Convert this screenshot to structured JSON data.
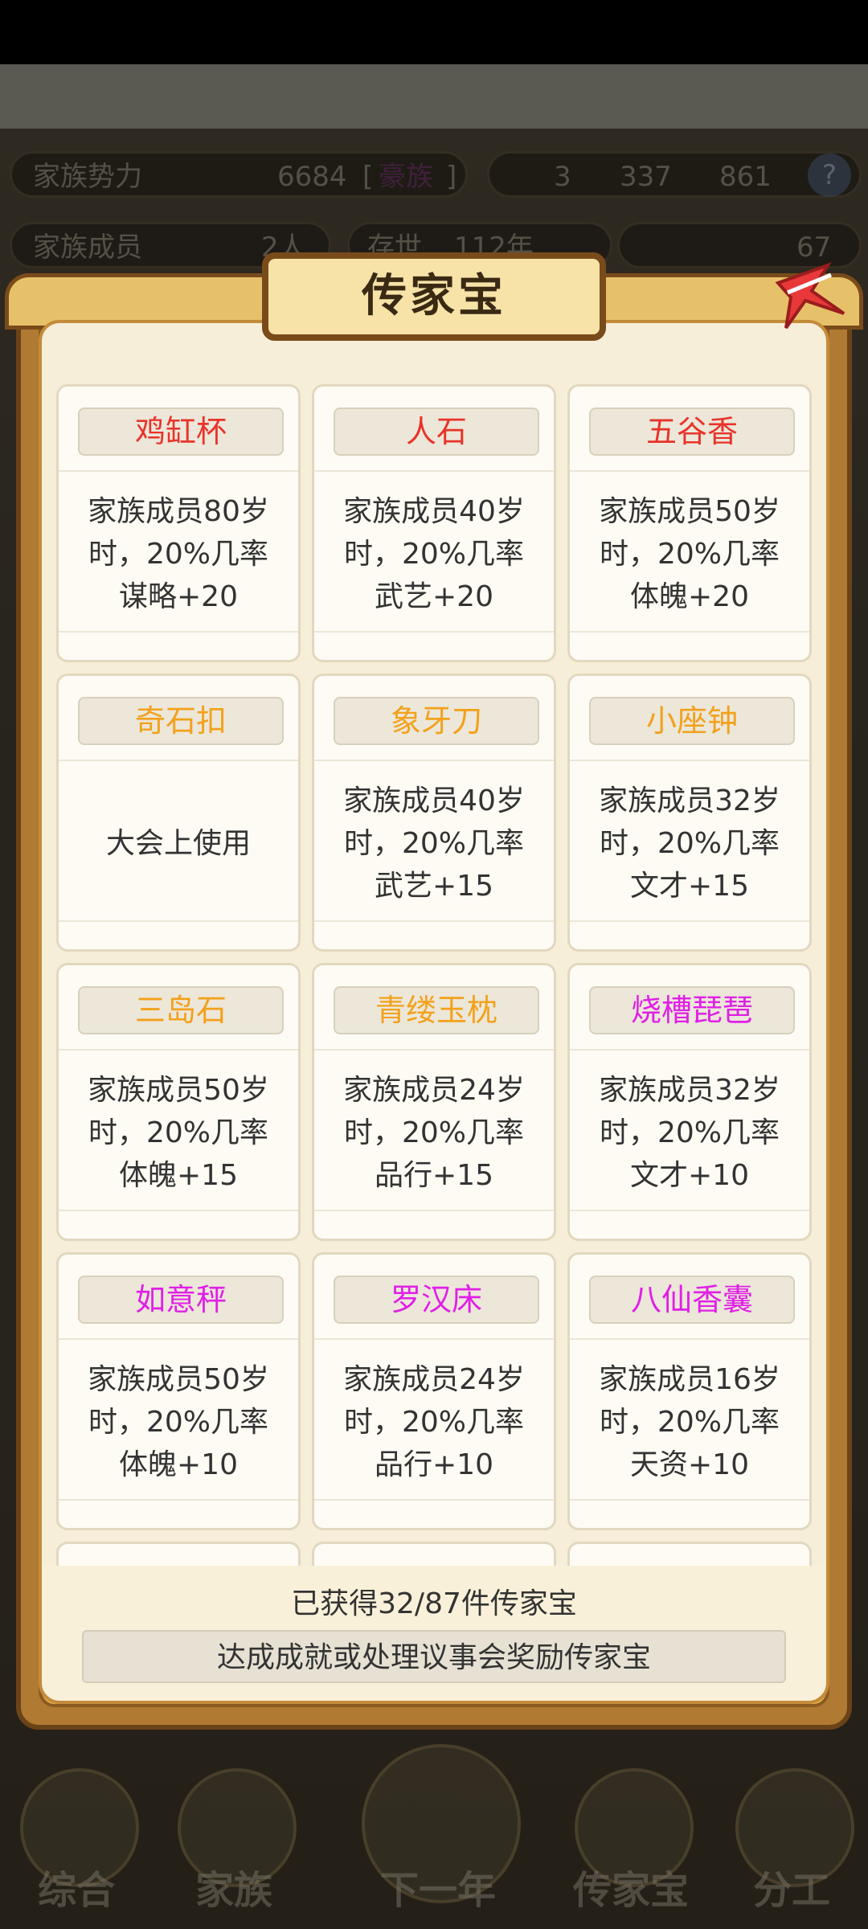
{
  "header": {
    "power_label": "家族势力",
    "power_value": "6684",
    "power_rank": "[",
    "power_rank_name": "豪族",
    "power_rank_end": "]",
    "res1": "3",
    "res2": "337",
    "res3": "861",
    "members_label": "家族成员",
    "members_value": "2人",
    "exist_label": "存世",
    "exist_value": "112年",
    "gold_value": "67"
  },
  "modal": {
    "title": "传家宝",
    "items": [
      {
        "name": "鸡缸杯",
        "color": "#e8332a",
        "desc": "家族成员80岁\n时，20%几率\n谋略+20"
      },
      {
        "name": "人石",
        "color": "#e8332a",
        "desc": "家族成员40岁\n时，20%几率\n武艺+20"
      },
      {
        "name": "五谷香",
        "color": "#e8332a",
        "desc": "家族成员50岁\n时，20%几率\n体魄+20"
      },
      {
        "name": "奇石扣",
        "color": "#f3a11c",
        "desc": "大会上使用"
      },
      {
        "name": "象牙刀",
        "color": "#f3a11c",
        "desc": "家族成员40岁\n时，20%几率\n武艺+15"
      },
      {
        "name": "小座钟",
        "color": "#f3a11c",
        "desc": "家族成员32岁\n时，20%几率\n文才+15"
      },
      {
        "name": "三岛石",
        "color": "#f3a11c",
        "desc": "家族成员50岁\n时，20%几率\n体魄+15"
      },
      {
        "name": "青缕玉枕",
        "color": "#f3a11c",
        "desc": "家族成员24岁\n时，20%几率\n品行+15"
      },
      {
        "name": "烧槽琵琶",
        "color": "#e020e6",
        "desc": "家族成员32岁\n时，20%几率\n文才+10"
      },
      {
        "name": "如意秤",
        "color": "#e020e6",
        "desc": "家族成员50岁\n时，20%几率\n体魄+10"
      },
      {
        "name": "罗汉床",
        "color": "#e020e6",
        "desc": "家族成员24岁\n时，20%几率\n品行+10"
      },
      {
        "name": "八仙香囊",
        "color": "#e020e6",
        "desc": "家族成员16岁\n时，20%几率\n天资+10"
      }
    ],
    "count_text": "已获得32/87件传家宝",
    "hint_text": "达成成就或处理议事会奖励传家宝"
  },
  "nav": [
    "综合",
    "家族",
    "下一年",
    "传家宝",
    "分工"
  ]
}
